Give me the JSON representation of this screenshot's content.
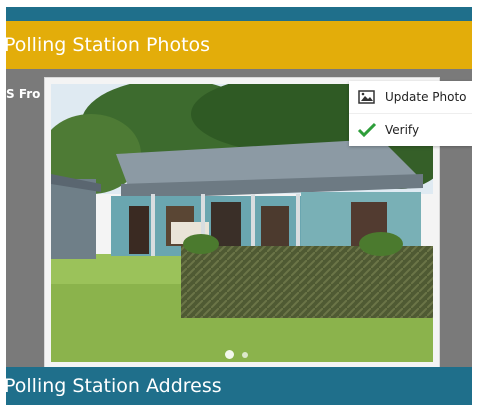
{
  "header": {
    "title": "Polling Station Photos"
  },
  "caption": "S Fro",
  "photo_menu": {
    "update_label": "Update Photo",
    "verify_label": "Verify"
  },
  "carousel": {
    "current_index": 1,
    "total": 2
  },
  "footer": {
    "title": "Polling Station Address"
  },
  "colors": {
    "header": "#e3ad0a",
    "footer": "#1f6f8b",
    "backdrop": "#7a7a7a",
    "verify_check": "#2e9e3a"
  }
}
